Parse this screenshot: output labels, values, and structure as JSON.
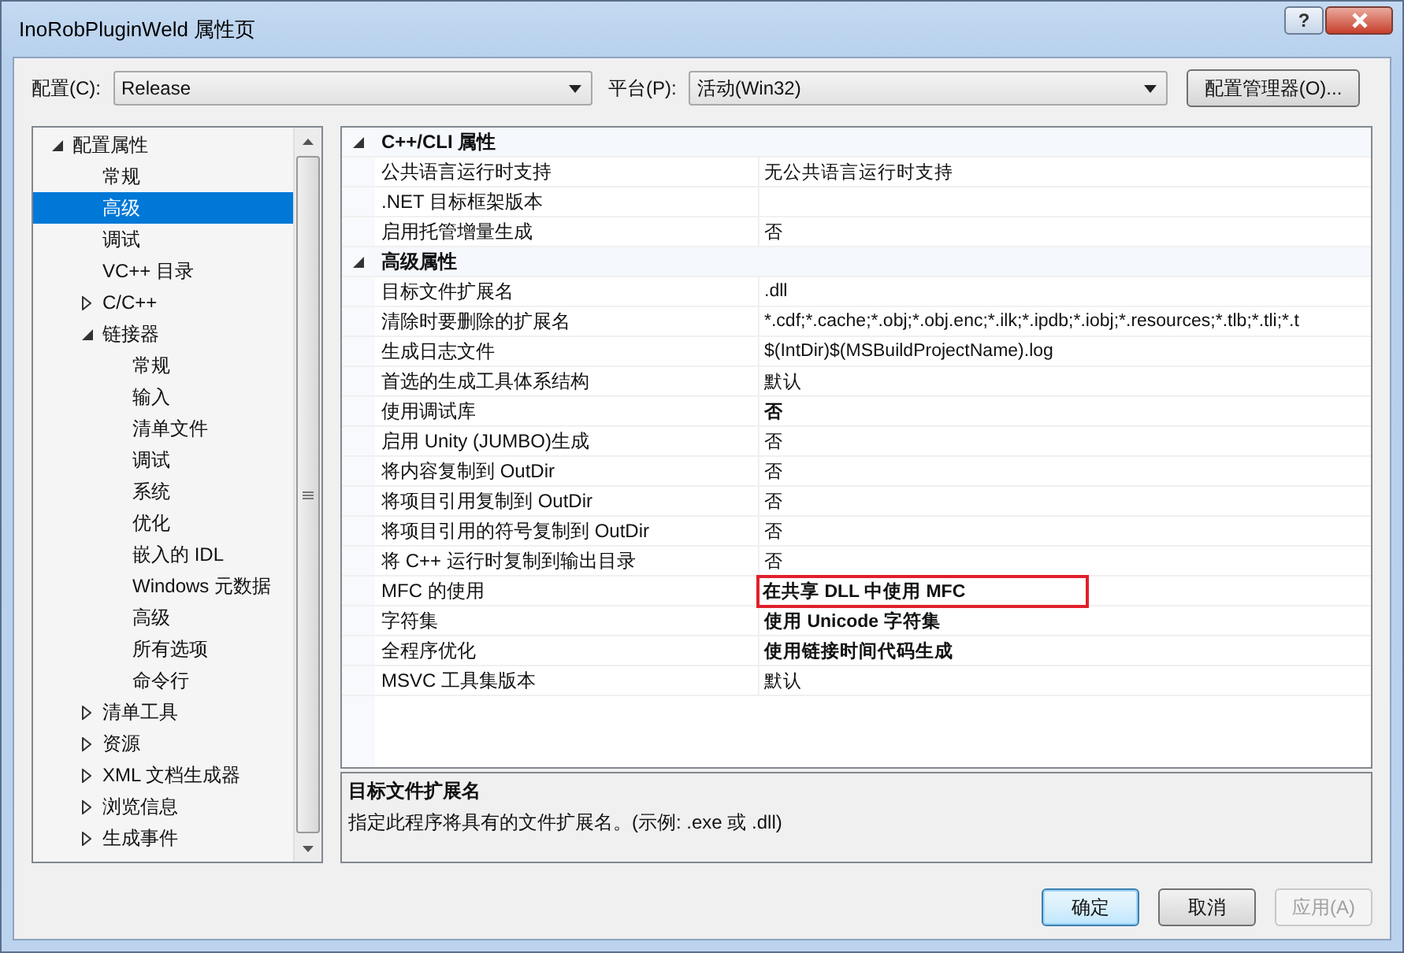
{
  "window": {
    "title": "InoRobPluginWeld 属性页",
    "help_button": "?"
  },
  "toolbar": {
    "configuration": {
      "label": "配置(C):",
      "value": "Release"
    },
    "platform": {
      "label": "平台(P):",
      "value": "活动(Win32)"
    },
    "manager_button": "配置管理器(O)..."
  },
  "tree": [
    {
      "label": "配置属性",
      "expanded": true,
      "selected": false,
      "children": [
        {
          "label": "常规",
          "selected": false
        },
        {
          "label": "高级",
          "selected": true
        },
        {
          "label": "调试",
          "selected": false
        },
        {
          "label": "VC++ 目录",
          "selected": false
        },
        {
          "label": "C/C++",
          "expanded": false,
          "selected": false
        },
        {
          "label": "链接器",
          "expanded": true,
          "selected": false,
          "children": [
            {
              "label": "常规",
              "selected": false
            },
            {
              "label": "输入",
              "selected": false
            },
            {
              "label": "清单文件",
              "selected": false
            },
            {
              "label": "调试",
              "selected": false
            },
            {
              "label": "系统",
              "selected": false
            },
            {
              "label": "优化",
              "selected": false
            },
            {
              "label": "嵌入的 IDL",
              "selected": false
            },
            {
              "label": "Windows 元数据",
              "selected": false
            },
            {
              "label": "高级",
              "selected": false
            },
            {
              "label": "所有选项",
              "selected": false
            },
            {
              "label": "命令行",
              "selected": false
            }
          ]
        },
        {
          "label": "清单工具",
          "expanded": false,
          "selected": false
        },
        {
          "label": "资源",
          "expanded": false,
          "selected": false
        },
        {
          "label": "XML 文档生成器",
          "expanded": false,
          "selected": false
        },
        {
          "label": "浏览信息",
          "expanded": false,
          "selected": false
        },
        {
          "label": "生成事件",
          "expanded": false,
          "selected": false
        }
      ]
    }
  ],
  "grid": {
    "categories": [
      {
        "title": "C++/CLI 属性",
        "expanded": true,
        "properties": [
          {
            "name": "公共语言运行时支持",
            "value": "无公共语言运行时支持",
            "bold": false,
            "highlighted": false
          },
          {
            "name": ".NET 目标框架版本"
          },
          {
            "name": "启用托管增量生成",
            "value": "否",
            "bold": false,
            "highlighted": false
          }
        ]
      },
      {
        "title": "高级属性",
        "expanded": true,
        "properties": [
          {
            "name": "目标文件扩展名",
            "value": ".dll",
            "bold": false,
            "highlighted": false
          },
          {
            "name": "清除时要删除的扩展名",
            "value": "*.cdf;*.cache;*.obj;*.obj.enc;*.ilk;*.ipdb;*.iobj;*.resources;*.tlb;*.tli;*.t",
            "bold": false,
            "highlighted": false
          },
          {
            "name": "生成日志文件",
            "value": "$(IntDir)$(MSBuildProjectName).log",
            "bold": false,
            "highlighted": false
          },
          {
            "name": "首选的生成工具体系结构",
            "value": "默认",
            "bold": false,
            "highlighted": false
          },
          {
            "name": "使用调试库",
            "value": "否",
            "bold": true,
            "highlighted": false
          },
          {
            "name": "启用 Unity (JUMBO)生成",
            "value": "否",
            "bold": false,
            "highlighted": false
          },
          {
            "name": "将内容复制到 OutDir",
            "value": "否",
            "bold": false,
            "highlighted": false
          },
          {
            "name": "将项目引用复制到 OutDir",
            "value": "否",
            "bold": false,
            "highlighted": false
          },
          {
            "name": "将项目引用的符号复制到 OutDir",
            "value": "否",
            "bold": false,
            "highlighted": false
          },
          {
            "name": "将 C++ 运行时复制到输出目录",
            "value": "否",
            "bold": false,
            "highlighted": false
          },
          {
            "name": "MFC 的使用",
            "value": "在共享 DLL 中使用 MFC",
            "bold": true,
            "highlighted": true
          },
          {
            "name": "字符集",
            "value": "使用 Unicode 字符集",
            "bold": true,
            "highlighted": false
          },
          {
            "name": "全程序优化",
            "value": "使用链接时间代码生成",
            "bold": true,
            "highlighted": false
          },
          {
            "name": "MSVC 工具集版本",
            "value": "默认",
            "bold": false,
            "highlighted": false
          }
        ]
      }
    ]
  },
  "description": {
    "title": "目标文件扩展名",
    "text": "指定此程序将具有的文件扩展名。(示例: .exe 或 .dll)"
  },
  "buttons": [
    {
      "label": "确定",
      "kind": "default",
      "disabled": false
    },
    {
      "label": "取消",
      "kind": "normal",
      "disabled": false
    },
    {
      "label": "应用(A)",
      "kind": "normal",
      "disabled": true
    }
  ]
}
